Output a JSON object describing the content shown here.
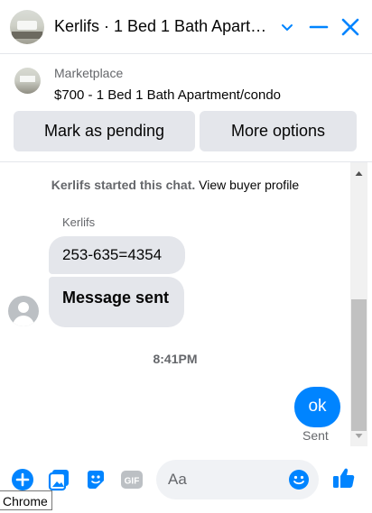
{
  "header": {
    "title": "Kerlifs · 1 Bed 1 Bath Apart…",
    "icons": [
      "chevron-down-icon",
      "minimize-icon",
      "close-icon"
    ],
    "accent": "#0084ff"
  },
  "listing": {
    "kind": "Marketplace",
    "title": "$700 - 1 Bed 1 Bath Apartment/condo",
    "buttons": {
      "pending": "Mark as pending",
      "more": "More options"
    }
  },
  "chat": {
    "notice_name": "Kerlifs started this chat.",
    "notice_link": "View buyer profile",
    "sender": "Kerlifs",
    "messages_in": [
      "253-635=4354",
      "Message sent"
    ],
    "time": "8:41PM",
    "message_out": "ok",
    "status": "Sent"
  },
  "composer": {
    "placeholder": "Aa",
    "icons": [
      "plus-circle-icon",
      "photo-icon",
      "sticker-icon",
      "gif-icon",
      "emoji-icon",
      "like-icon"
    ],
    "gif_label": "GIF"
  },
  "tooltip": "Chrome"
}
